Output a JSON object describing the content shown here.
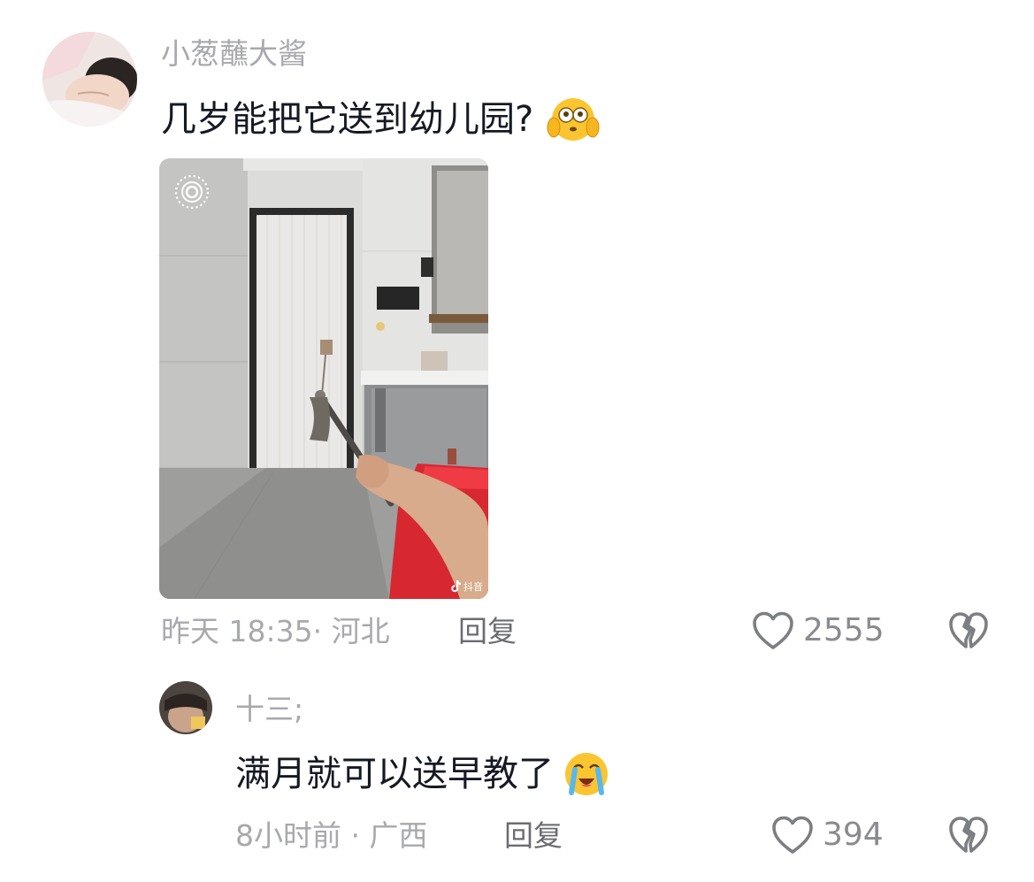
{
  "comments": [
    {
      "username": "小葱蘸大酱",
      "text": "几岁能把它送到幼儿园?",
      "emoji": "shocked-hands-cheeks-emoji",
      "meta": "昨天 18:35· 河北",
      "reply_label": "回复",
      "likes": "2555",
      "media": {
        "watermark": "抖音",
        "live_icon": "live-photo-icon"
      }
    },
    {
      "username": "十三;",
      "text": "满月就可以送早教了",
      "emoji": "crying-face-emoji",
      "meta": "8小时前 · 广西",
      "reply_label": "回复",
      "likes": "394"
    }
  ],
  "icons": {
    "like": "heart-outline-icon",
    "dislike": "broken-heart-icon"
  },
  "colors": {
    "text_primary": "#161823",
    "text_secondary": "#a8a9ad",
    "reply": "#6b6c70"
  }
}
